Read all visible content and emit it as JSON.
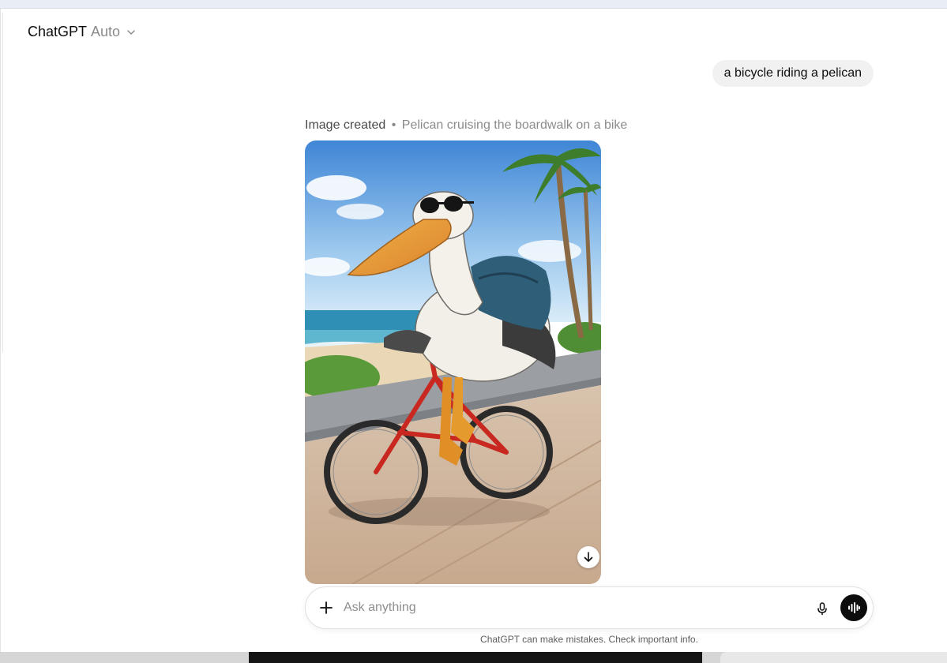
{
  "header": {
    "title": "ChatGPT",
    "model": "Auto"
  },
  "conversation": {
    "user_message": "a bicycle riding a pelican",
    "image_status": "Image created",
    "separator": "•",
    "image_title": "Pelican cruising the boardwalk on a bike"
  },
  "composer": {
    "placeholder": "Ask anything"
  },
  "footer": {
    "disclaimer": "ChatGPT can make mistakes. Check important info."
  },
  "icons": [
    "chevron-down-icon",
    "download-icon",
    "plus-icon",
    "microphone-icon",
    "voice-mode-icon"
  ]
}
